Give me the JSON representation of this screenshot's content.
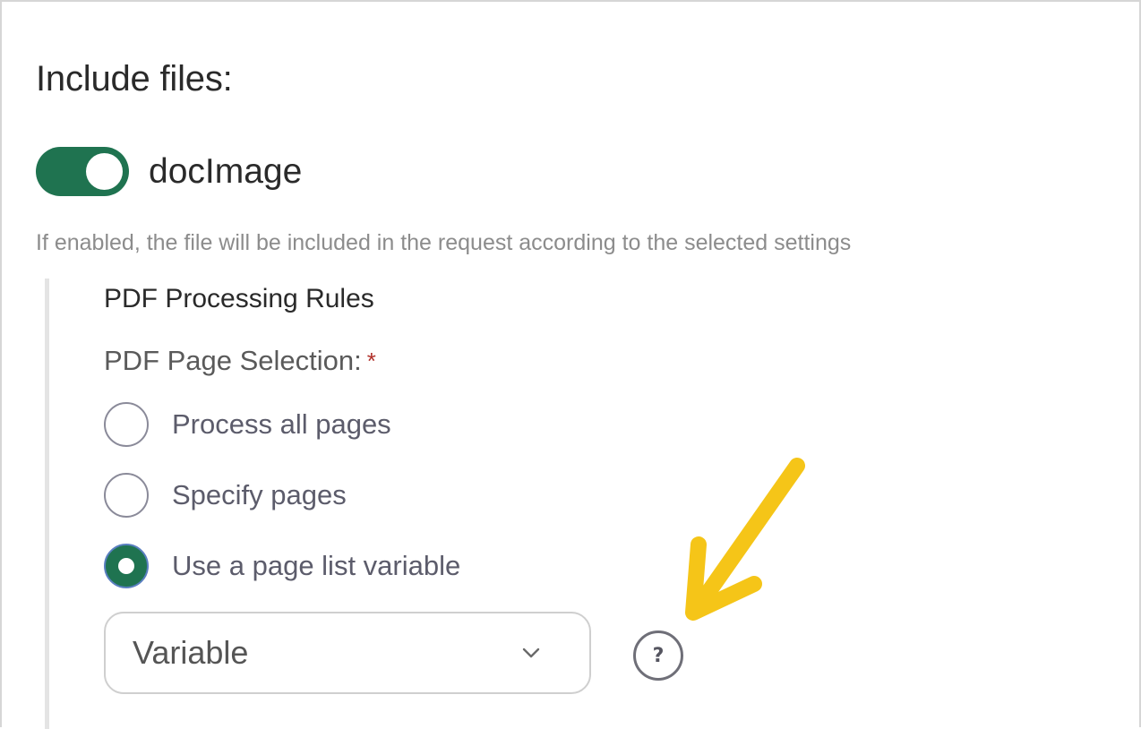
{
  "section": {
    "title": "Include files:"
  },
  "toggle": {
    "label": "docImage",
    "enabled": true,
    "color": "#1f7350"
  },
  "help_text": "If enabled, the file will be included in the request according to the selected settings",
  "rules": {
    "heading": "PDF Processing Rules",
    "page_selection": {
      "label": "PDF Page Selection:",
      "required_marker": "*",
      "options": [
        {
          "label": "Process all pages",
          "selected": false
        },
        {
          "label": "Specify pages",
          "selected": false
        },
        {
          "label": "Use a page list variable",
          "selected": true
        }
      ],
      "variable_select": {
        "value": "Variable",
        "icon": "chevron-down-icon"
      },
      "help_icon": "question-mark-icon"
    }
  },
  "annotation": {
    "icon": "pointer-arrow-icon",
    "color": "#f5c518"
  }
}
